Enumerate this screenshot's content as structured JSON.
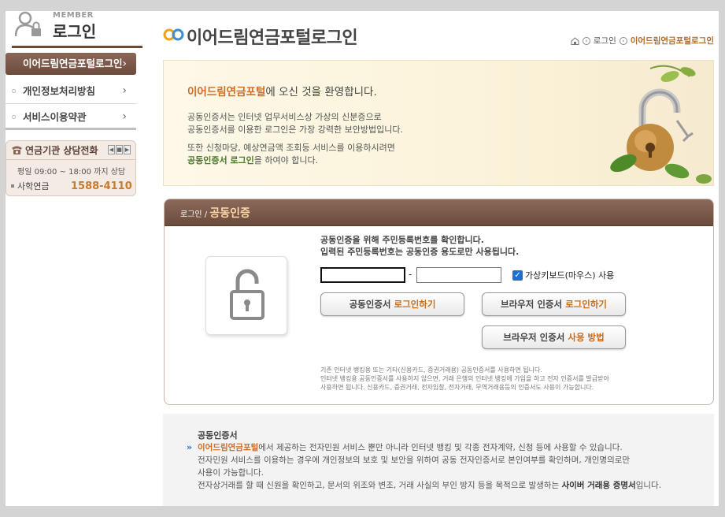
{
  "sidebar": {
    "member_small": "MEMBER",
    "member_title": "로그인",
    "items": [
      {
        "label": "이어드림연금포털로그인",
        "active": true
      },
      {
        "label": "개인정보처리방침"
      },
      {
        "label": "서비스이용약관"
      }
    ],
    "consult": {
      "title": "연금기관 상담전화",
      "hours": "평일  09:00 ~ 18:00  까지 상담",
      "name": "사학연금",
      "number": "1588-4110"
    }
  },
  "header": {
    "title": "이어드림연금포털로그인",
    "breadcrumb": [
      "로그인",
      "이어드림연금포털로그인"
    ]
  },
  "welcome": {
    "title_hl": "이어드림연금포털",
    "title_rest": "에 오신 것을 환영합니다.",
    "p1_line1": "공동인증서는 인터넷 업무서비스상 가상의 신분증으로",
    "p1_line2": "공동인증서를 이용한 로그인은 가장 강력한 보안방법입니다.",
    "p2_line1": "또한 신청마당, 예상연금액 조회등 서비스를 이용하시려면",
    "p2_hl": "공동인증서 로그인",
    "p2_rest": "을 하여야 합니다."
  },
  "cert": {
    "head_small": "로그인 / ",
    "head_big": "공동인증",
    "info_line1": "공동인증을 위해 주민등록번호를 확인합니다.",
    "info_line2": "입력된 주민등록번호는 공동인증 용도로만 사용됩니다.",
    "rrn1_value": "",
    "rrn2_value": "",
    "dash": "-",
    "vk_label": "가상키보드(마우스) 사용",
    "btn1_a": "공동인증서 ",
    "btn1_b": "로그인하기",
    "btn2_a": "브라우저 인증서 ",
    "btn2_b": "로그인하기",
    "btn3_a": "브라우저 인증서 ",
    "btn3_b": "사용 방법",
    "note_line1": "기존 인터넷 뱅킹용 또는 기타(신용카드, 증권거래용) 공동인증서를 사용하면 됩니다.",
    "note_line2": "인터넷 뱅킹용 공동인증서를 사용하지 않으면, 거래 은행의 인터넷 뱅킹에 가입을 하고 전자 인증서를 발급받아",
    "note_line3": "사용하면 됩니다. 신용카드, 증권거래, 전자입찰, 전자거래, 무역거래용등의 인증서도 사용이 가능합니다."
  },
  "footer": {
    "title": "공동인증서",
    "arrow": "»",
    "l1_hl": "이어드림연금포털",
    "l1_rest": "에서 제공하는 전자민원 서비스 뿐만 아니라 인터넷 뱅킹 및 각종 전자계약, 신청 등에 사용할 수 있습니다.",
    "l2": "전자민원 서비스를 이용하는 경우에 개인정보의 보호 및 보안을 위하여 공동 전자인증서로 본인여부를 확인하며, 개인명의로만",
    "l3": "사용이 가능합니다.",
    "l4_a": "전자상거래를 할 때 신원을 확인하고, 문서의 위조와 변조, 거래 사실의 부인 방지 등을 목적으로 발생하는 ",
    "l4_bd": "사이버 거래용 증명서",
    "l4_c": "입니다."
  },
  "colors": {
    "brown": "#6e4c3d",
    "orange": "#d46a20",
    "green": "#4a7b2a",
    "phone_orange": "#c97a2c"
  }
}
